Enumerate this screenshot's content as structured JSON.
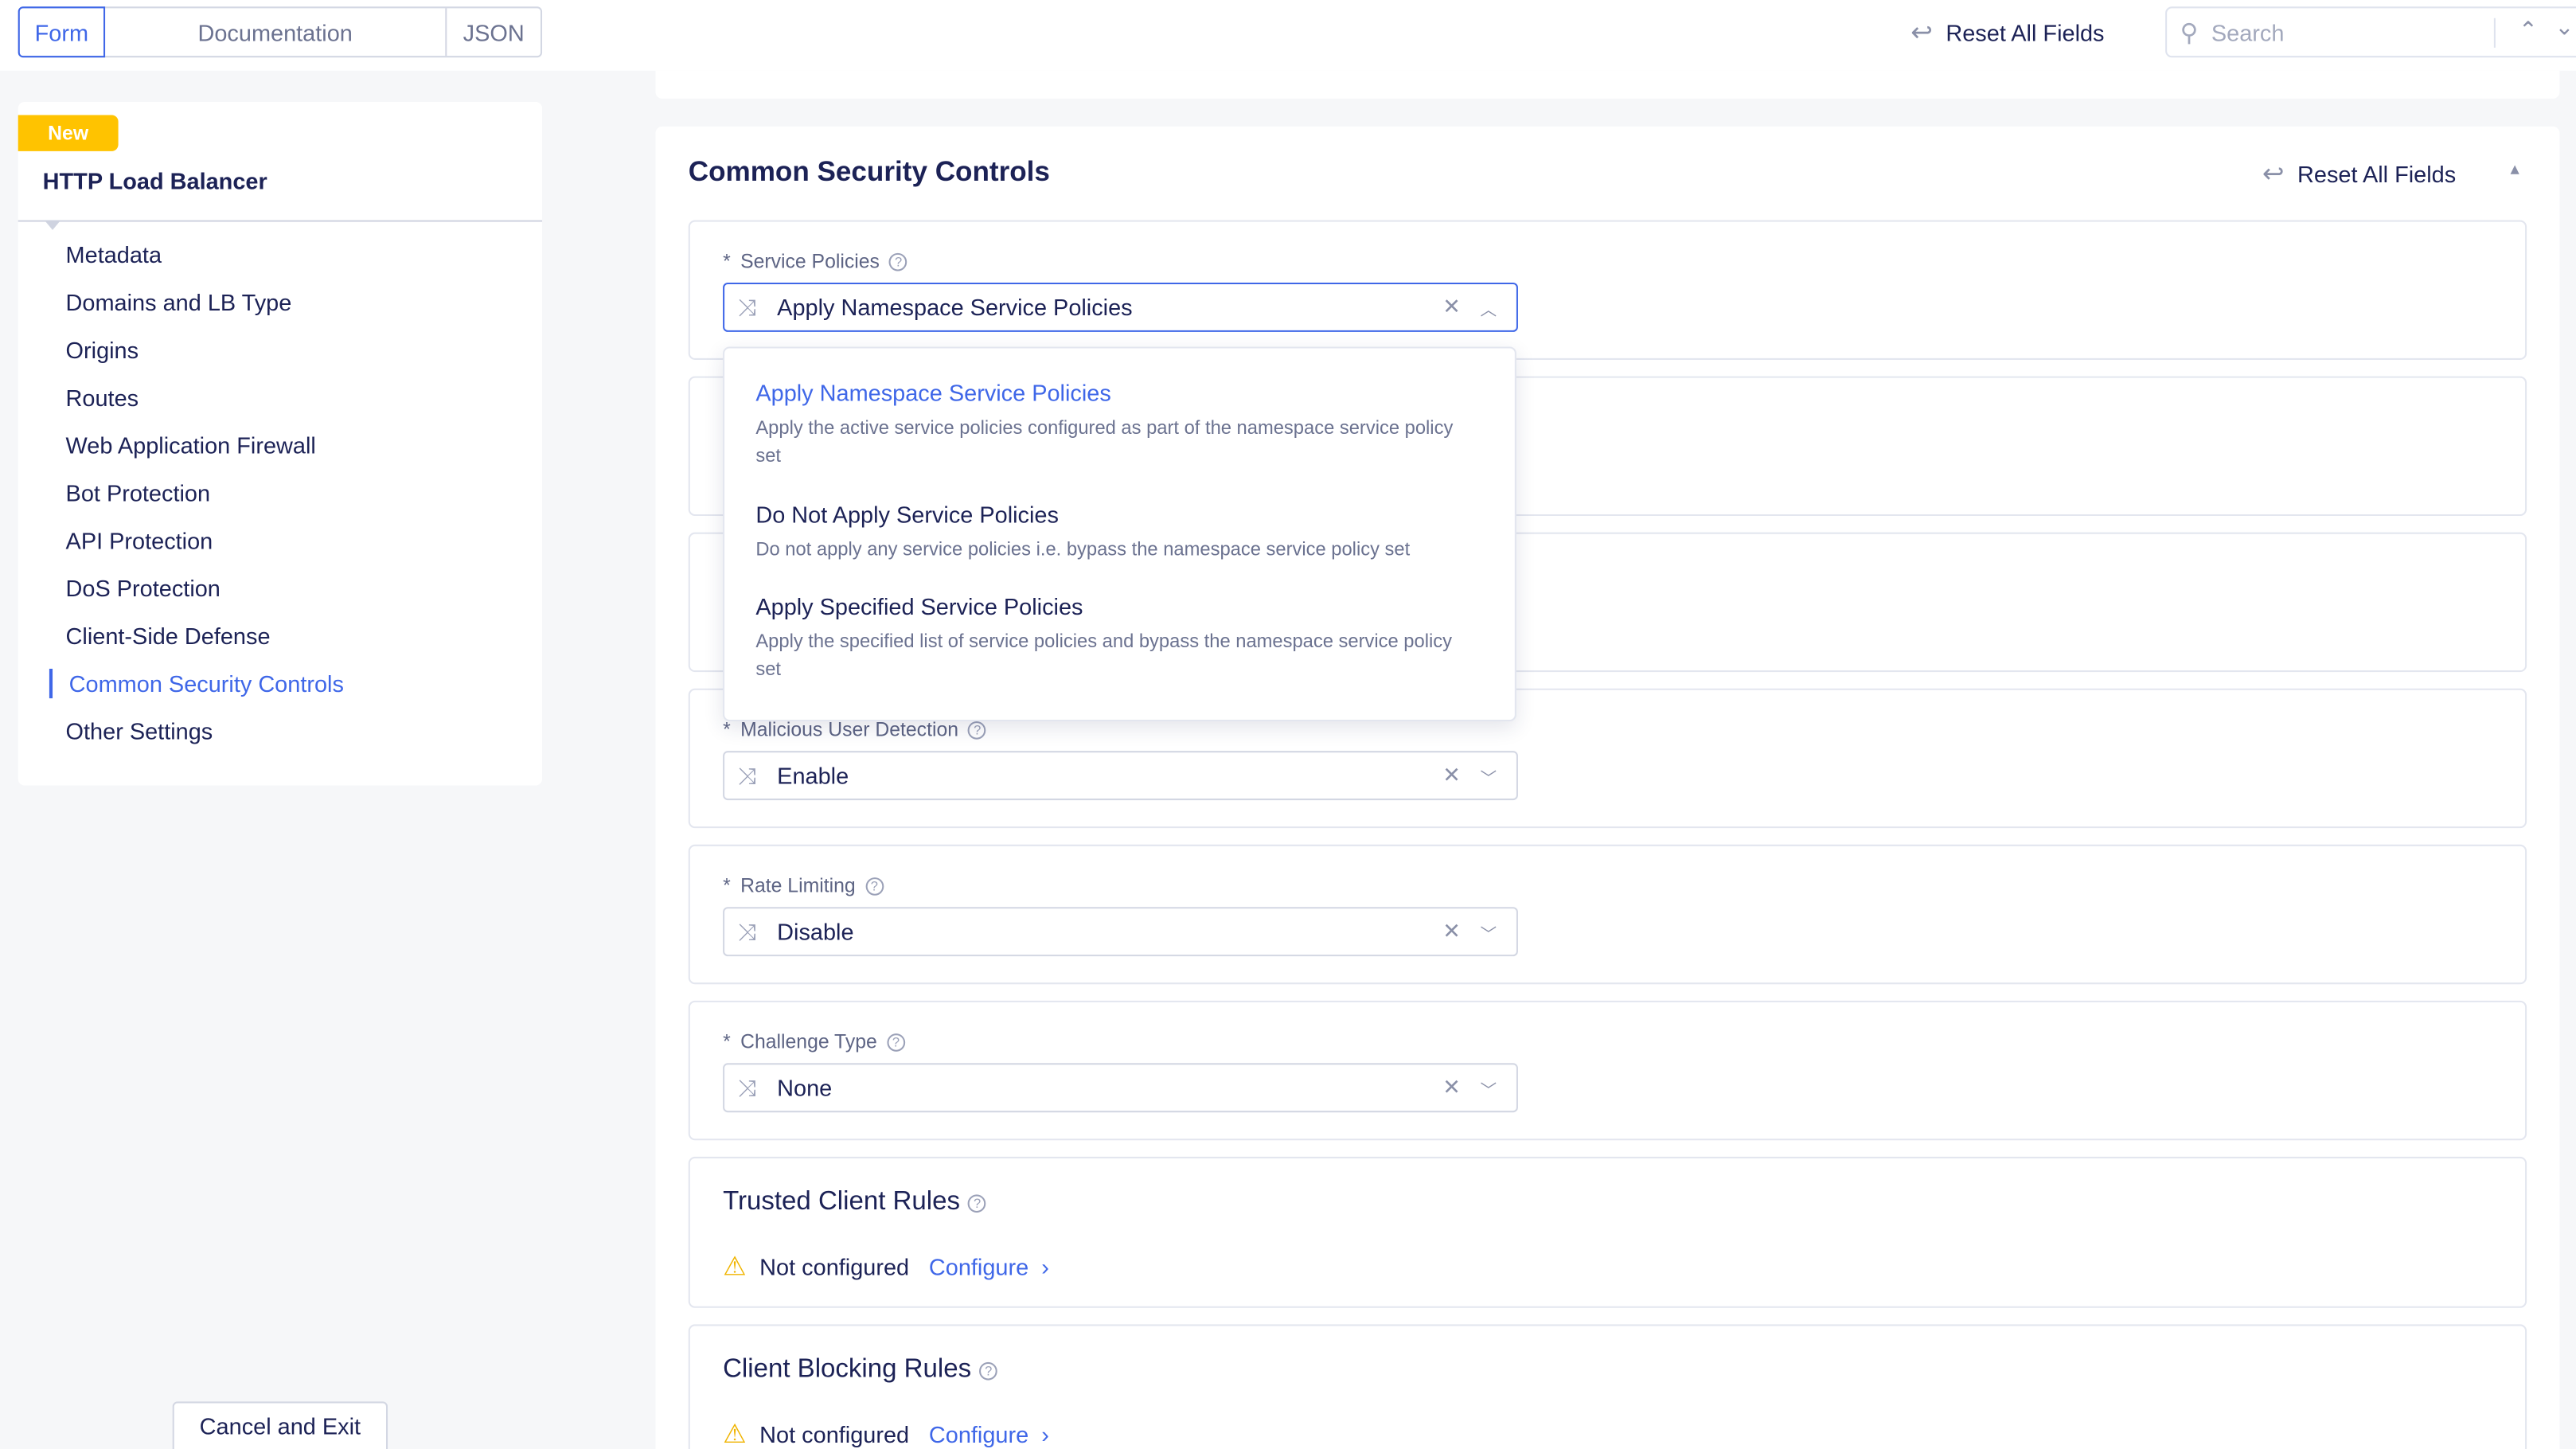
{
  "top_tabs": [
    {
      "label": "Form",
      "active": true
    },
    {
      "label": "Documentation"
    },
    {
      "label": "JSON"
    }
  ],
  "header": {
    "reset_label": "Reset All Fields",
    "search_placeholder": "Search"
  },
  "sidebar": {
    "badge": "New",
    "title": "HTTP Load Balancer",
    "items": [
      {
        "label": "Metadata"
      },
      {
        "label": "Domains and LB Type"
      },
      {
        "label": "Origins"
      },
      {
        "label": "Routes"
      },
      {
        "label": "Web Application Firewall"
      },
      {
        "label": "Bot Protection"
      },
      {
        "label": "API Protection"
      },
      {
        "label": "DoS Protection"
      },
      {
        "label": "Client-Side Defense"
      },
      {
        "label": "Common Security Controls",
        "active": true
      },
      {
        "label": "Other Settings"
      }
    ],
    "cancel_label": "Cancel and Exit"
  },
  "main": {
    "title": "Common Security Controls",
    "reset_label": "Reset All Fields",
    "fields": [
      {
        "label": "Service Policies",
        "value": "Apply Namespace Service Policies",
        "open": true
      },
      {
        "label": "Malicious User Detection",
        "value": "Enable"
      },
      {
        "label": "Rate Limiting",
        "value": "Disable"
      },
      {
        "label": "Challenge Type",
        "value": "None"
      }
    ],
    "dropdown_options": [
      {
        "title": "Apply Namespace Service Policies",
        "desc": "Apply the active service policies configured as part of the namespace service policy set",
        "selected": true
      },
      {
        "title": "Do Not Apply Service Policies",
        "desc": "Do not apply any service policies i.e. bypass the namespace service policy set"
      },
      {
        "title": "Apply Specified Service Policies",
        "desc": "Apply the specified list of service policies and bypass the namespace service policy set"
      }
    ],
    "rules": [
      {
        "title": "Trusted Client Rules",
        "status": "Not configured",
        "action": "Configure"
      },
      {
        "title": "Client Blocking Rules",
        "status": "Not configured",
        "action": "Configure"
      }
    ]
  },
  "colors": {
    "accent": "#3f67e8",
    "badge": "#ffc300",
    "text": "#1c2256",
    "warning": "#f0b400"
  }
}
